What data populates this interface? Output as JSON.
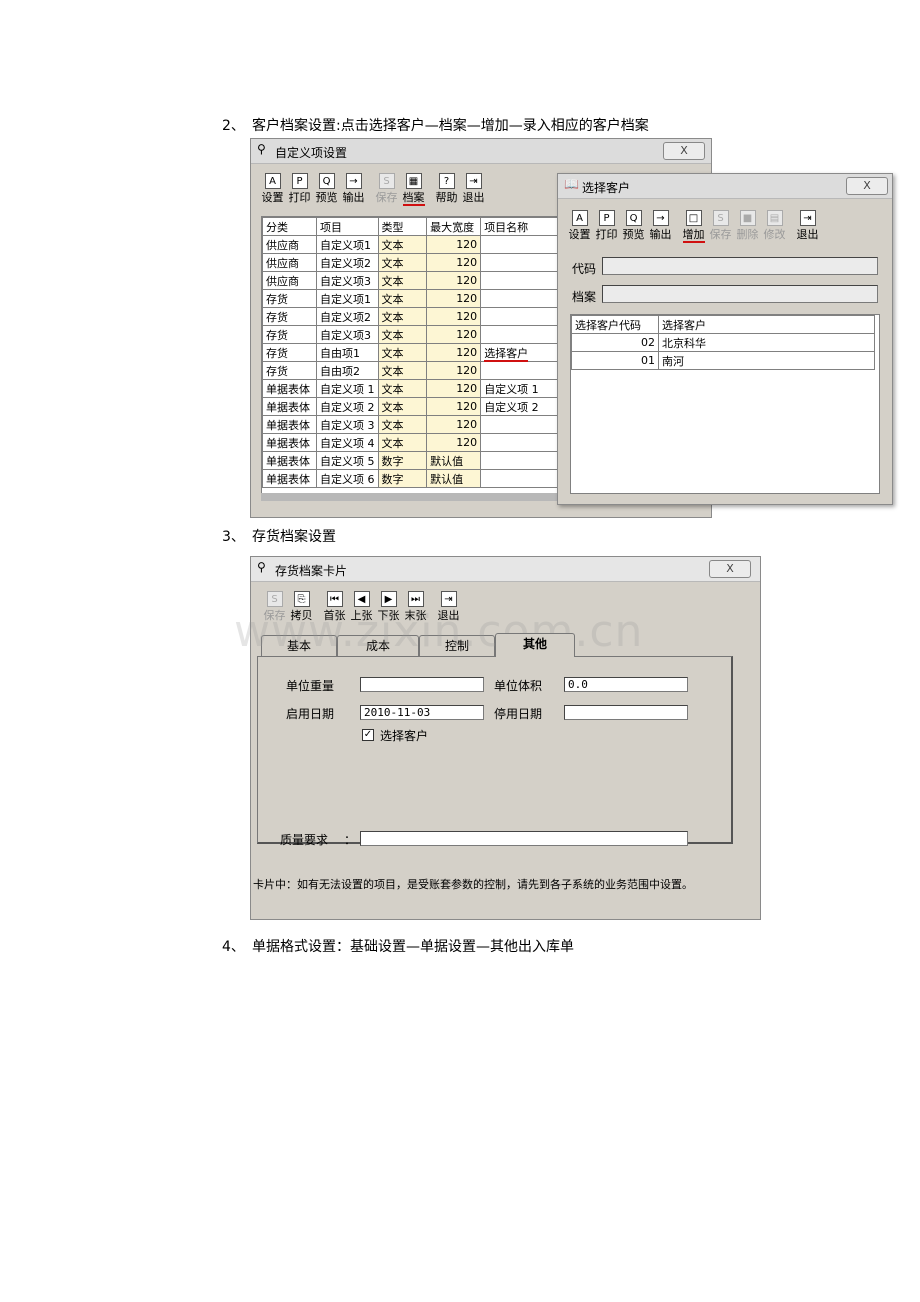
{
  "headings": [
    {
      "num": "2、",
      "text": "客户档案设置:点击选择客户—档案—增加—录入相应的客户档案"
    },
    {
      "num": "3、",
      "text": "存货档案设置"
    },
    {
      "num": "4、",
      "text": "单据格式设置：基础设置—单据设置—其他出入库单"
    }
  ],
  "win1": {
    "title": "自定义项设置",
    "close": "X",
    "toolbar": [
      {
        "label": "设置",
        "icon": "A",
        "state": "normal"
      },
      {
        "label": "打印",
        "icon": "P",
        "state": "normal"
      },
      {
        "label": "预览",
        "icon": "Q",
        "state": "normal"
      },
      {
        "label": "输出",
        "icon": "→",
        "state": "normal"
      },
      {
        "label": "保存",
        "icon": "S",
        "state": "disabled"
      },
      {
        "label": "档案",
        "icon": "▦",
        "state": "selected"
      },
      {
        "label": "帮助",
        "icon": "?",
        "state": "normal"
      },
      {
        "label": "退出",
        "icon": "⇥",
        "state": "normal"
      }
    ],
    "columns": [
      "分类",
      "项目",
      "类型",
      "最大宽度",
      "项目名称"
    ],
    "rows": [
      [
        "供应商",
        "自定义项1",
        "文本",
        "120",
        ""
      ],
      [
        "供应商",
        "自定义项2",
        "文本",
        "120",
        ""
      ],
      [
        "供应商",
        "自定义项3",
        "文本",
        "120",
        ""
      ],
      [
        "存货",
        "自定义项1",
        "文本",
        "120",
        ""
      ],
      [
        "存货",
        "自定义项2",
        "文本",
        "120",
        ""
      ],
      [
        "存货",
        "自定义项3",
        "文本",
        "120",
        ""
      ],
      [
        "存货",
        "自由项1",
        "文本",
        "120",
        "选择客户"
      ],
      [
        "存货",
        "自由项2",
        "文本",
        "120",
        ""
      ],
      [
        "单据表体",
        "自定义项 1",
        "文本",
        "120",
        "自定义项 1"
      ],
      [
        "单据表体",
        "自定义项 2",
        "文本",
        "120",
        "自定义项 2"
      ],
      [
        "单据表体",
        "自定义项 3",
        "文本",
        "120",
        ""
      ],
      [
        "单据表体",
        "自定义项 4",
        "文本",
        "120",
        ""
      ],
      [
        "单据表体",
        "自定义项 5",
        "数字",
        "默认值",
        ""
      ],
      [
        "单据表体",
        "自定义项 6",
        "数字",
        "默认值",
        ""
      ]
    ]
  },
  "win2": {
    "title": "选择客户",
    "close": "X",
    "toolbar": [
      {
        "label": "设置",
        "icon": "A",
        "state": "normal"
      },
      {
        "label": "打印",
        "icon": "P",
        "state": "normal"
      },
      {
        "label": "预览",
        "icon": "Q",
        "state": "normal"
      },
      {
        "label": "输出",
        "icon": "→",
        "state": "normal"
      },
      {
        "label": "增加",
        "icon": "□",
        "state": "selected"
      },
      {
        "label": "保存",
        "icon": "S",
        "state": "disabled"
      },
      {
        "label": "删除",
        "icon": "■",
        "state": "disabled"
      },
      {
        "label": "修改",
        "icon": "▤",
        "state": "disabled"
      },
      {
        "label": "退出",
        "icon": "⇥",
        "state": "normal"
      }
    ],
    "code_label": "代码",
    "archive_label": "档案",
    "code_value": "",
    "archive_value": "",
    "columns": [
      "选择客户代码",
      "选择客户"
    ],
    "rows": [
      [
        "02",
        "北京科华"
      ],
      [
        "01",
        "南河"
      ]
    ]
  },
  "win3": {
    "title": "存货档案卡片",
    "close": "X",
    "toolbar": [
      {
        "label": "保存",
        "icon": "S",
        "state": "disabled"
      },
      {
        "label": "拷贝",
        "icon": "⎘",
        "state": "normal"
      },
      {
        "label": "首张",
        "icon": "⏮",
        "state": "normal"
      },
      {
        "label": "上张",
        "icon": "◀",
        "state": "normal"
      },
      {
        "label": "下张",
        "icon": "▶",
        "state": "normal"
      },
      {
        "label": "末张",
        "icon": "⏭",
        "state": "normal"
      },
      {
        "label": "退出",
        "icon": "⇥",
        "state": "normal"
      }
    ],
    "tabs": [
      "基本",
      "成本",
      "控制",
      "其他"
    ],
    "active_tab": "其他",
    "unit_weight_label": "单位重量",
    "unit_weight_value": "",
    "unit_volume_label": "单位体积",
    "unit_volume_value": "0.0",
    "start_date_label": "启用日期",
    "start_date_value": "2010-11-03",
    "stop_date_label": "停用日期",
    "stop_date_value": "",
    "checkbox_label": "选择客户",
    "checkbox_checked": true,
    "checkbox_mark": "✓",
    "quality_label": "质量要求",
    "quality_colon": "：",
    "quality_value": "",
    "note": "卡片中：如有无法设置的项目，是受账套参数的控制，请先到各子系统的业务范围中设置。"
  },
  "watermark": "www.zixin.com.cn",
  "colors": {
    "accent_underline": "#d01010",
    "grid_yellow": "#fdf6d4",
    "window_gray": "#d4d0c8"
  }
}
